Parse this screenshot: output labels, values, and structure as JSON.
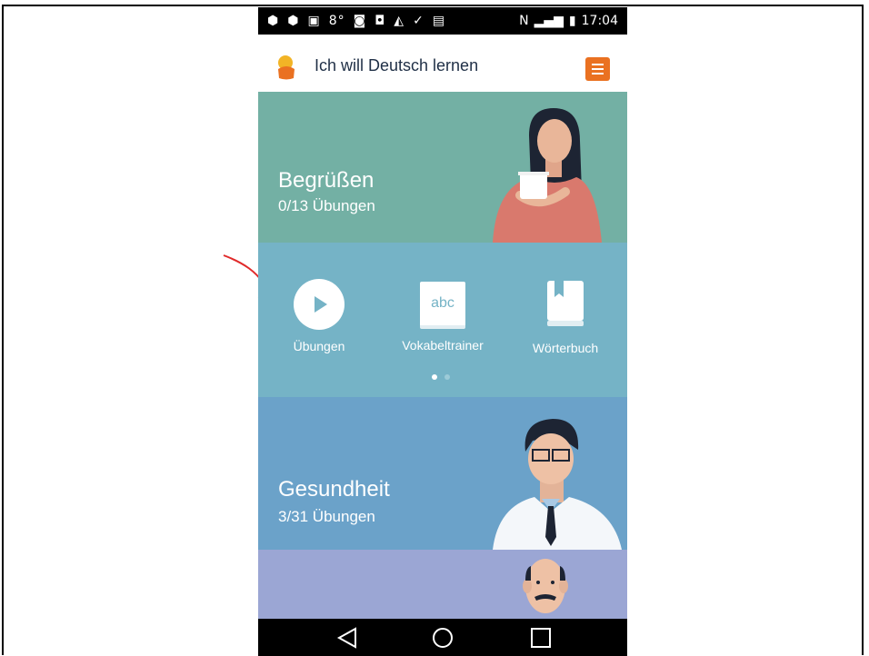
{
  "status_bar": {
    "left_icons": [
      "app-icon",
      "app-icon",
      "image-icon",
      "8°",
      "instagram-icon",
      "app-icon",
      "navigation-icon",
      "download-done-icon",
      "clipboard-icon"
    ],
    "right_icons": [
      "nfc-icon",
      "signal-icon",
      "battery-icon"
    ],
    "time": "17:04"
  },
  "app_bar": {
    "title": "Ich will Deutsch lernen",
    "menu_icon": "hamburger-menu-icon"
  },
  "lessons": [
    {
      "title": "Begrüßen",
      "progress": "0/13 Übungen"
    },
    {
      "title": "Gesundheit",
      "progress": "3/31 Übungen"
    }
  ],
  "actions": [
    {
      "label": "Übungen",
      "icon": "play-icon"
    },
    {
      "label": "Vokabeltrainer",
      "icon": "abc-card-icon",
      "icon_text": "abc"
    },
    {
      "label": "Wörterbuch",
      "icon": "book-icon"
    }
  ],
  "pager": {
    "page": 1,
    "pages": 2
  },
  "annotation": {
    "arrow_color": "#e02a2a",
    "points_to": "Übungen"
  },
  "colors": {
    "greet_card": "#73b0a4",
    "actions_card": "#75b3c6",
    "health_card": "#6ba2c9",
    "next_card": "#9ba6d4",
    "accent": "#ea7121"
  }
}
